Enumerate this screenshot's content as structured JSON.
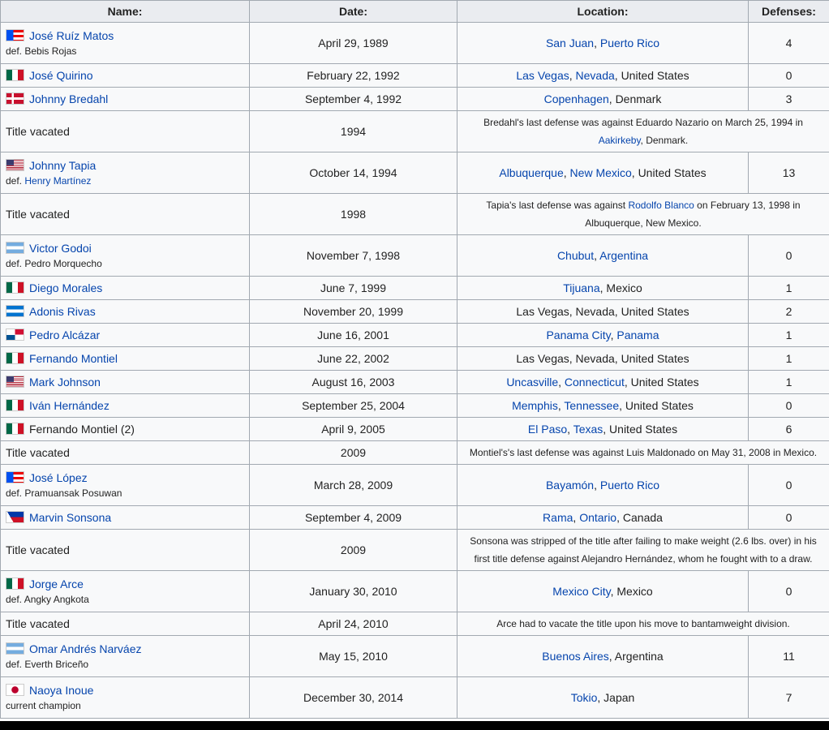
{
  "headers": {
    "name": "Name:",
    "date": "Date:",
    "location": "Location:",
    "defenses": "Defenses:"
  },
  "rows": {
    "r1": {
      "name": "José Ruíz Matos",
      "sub": "def. Bebis Rojas",
      "date": "April 29, 1989",
      "loc1": "San Juan",
      "sep1": ", ",
      "loc2": "Puerto Rico",
      "def": "4",
      "flag": "puerto-rico-flag-icon"
    },
    "r2": {
      "name": "José Quirino",
      "date": "February 22, 1992",
      "loc1": "Las Vegas",
      "sep1": ", ",
      "loc2": "Nevada",
      "loc3": ", United States",
      "def": "0",
      "flag": "mexico-flag-icon"
    },
    "r3": {
      "name": "Johnny Bredahl",
      "date": "September 4, 1992",
      "loc1": "Copenhagen",
      "loc3": ", Denmark",
      "def": "3",
      "flag": "denmark-flag-icon"
    },
    "r4": {
      "name": "Title vacated",
      "date": "1994",
      "n1": "Bredahl's last defense was against Eduardo Nazario on March 25, 1994 in ",
      "n2": "Aakirkeby",
      "n3": ", Denmark."
    },
    "r5": {
      "name": "Johnny Tapia",
      "subpre": "def. ",
      "sublink": "Henry Martínez",
      "date": "October 14, 1994",
      "loc1": "Albuquerque",
      "sep1": ", ",
      "loc2": "New Mexico",
      "loc3": ", United States",
      "def": "13",
      "flag": "united-states-flag-icon"
    },
    "r6": {
      "name": "Title vacated",
      "date": "1998",
      "n1": "Tapia's last defense was against ",
      "n2": "Rodolfo Blanco",
      "n3": " on February 13, 1998 in Albuquerque, New Mexico."
    },
    "r7": {
      "name": "Victor Godoi",
      "sub": "def. Pedro Morquecho",
      "date": "November 7, 1998",
      "loc1": "Chubut",
      "sep1": ", ",
      "loc2": "Argentina",
      "def": "0",
      "flag": "argentina-flag-icon"
    },
    "r8": {
      "name": "Diego Morales",
      "date": "June 7, 1999",
      "loc1": "Tijuana",
      "loc3": ", Mexico",
      "def": "1",
      "flag": "mexico-flag-icon"
    },
    "r9": {
      "name": "Adonis Rivas",
      "date": "November 20, 1999",
      "loc3": "Las Vegas, Nevada, United States",
      "def": "2",
      "flag": "honduras-flag-icon"
    },
    "r10": {
      "name": "Pedro Alcázar",
      "date": "June 16, 2001",
      "loc1": "Panama City",
      "sep1": ", ",
      "loc2": "Panama",
      "def": "1",
      "flag": "panama-flag-icon"
    },
    "r11": {
      "name": "Fernando Montiel",
      "date": "June 22, 2002",
      "loc3": "Las Vegas, Nevada, United States",
      "def": "1",
      "flag": "mexico-flag-icon"
    },
    "r12": {
      "name": "Mark Johnson",
      "date": "August 16, 2003",
      "loc1": "Uncasville",
      "sep1": ", ",
      "loc2": "Connecticut",
      "loc3": ", United States",
      "def": "1",
      "flag": "united-states-flag-icon"
    },
    "r13": {
      "name": "Iván Hernández",
      "date": "September 25, 2004",
      "loc1": "Memphis",
      "sep1": ", ",
      "loc2": "Tennessee",
      "loc3": ", United States",
      "def": "0",
      "flag": "mexico-flag-icon"
    },
    "r14": {
      "name": "Fernando Montiel (2)",
      "date": "April 9, 2005",
      "loc1": "El Paso",
      "sep1": ", ",
      "loc2": "Texas",
      "loc3": ", United States",
      "def": "6",
      "flag": "mexico-flag-icon"
    },
    "r15": {
      "name": "Title vacated",
      "date": "2009",
      "n1": "Montiel's's last defense was against Luis Maldonado on May 31, 2008 in Mexico."
    },
    "r16": {
      "name": "José López",
      "sub": "def. Pramuansak Posuwan",
      "date": "March 28, 2009",
      "loc1": "Bayamón",
      "sep1": ", ",
      "loc2": "Puerto Rico",
      "def": "0",
      "flag": "puerto-rico-flag-icon"
    },
    "r17": {
      "name": "Marvin Sonsona",
      "date": "September 4, 2009",
      "loc1": "Rama",
      "sep1": ", ",
      "loc2": "Ontario",
      "loc3": ", Canada",
      "def": "0",
      "flag": "philippines-flag-icon"
    },
    "r18": {
      "name": "Title vacated",
      "date": "2009",
      "n1": "Sonsona was stripped of the title after failing to make weight (2.6 lbs. over) in his first title defense against Alejandro Hernández, whom he fought with to a draw."
    },
    "r19": {
      "name": "Jorge Arce",
      "sub": "def. Angky Angkota",
      "date": "January 30, 2010",
      "loc1": "Mexico City",
      "loc3": ", Mexico",
      "def": "0",
      "flag": "mexico-flag-icon"
    },
    "r20": {
      "name": "Title vacated",
      "date": "April 24, 2010",
      "n1": "Arce had to vacate the title upon his move to bantamweight division."
    },
    "r21": {
      "name": "Omar Andrés Narváez",
      "sub": "def. Everth Briceño",
      "date": "May 15, 2010",
      "loc1": "Buenos Aires",
      "loc3": ", Argentina",
      "def": "11",
      "flag": "argentina-flag-icon"
    },
    "r22": {
      "name": "Naoya Inoue",
      "sub": "current champion",
      "date": "December 30, 2014",
      "loc1": "Tokio",
      "loc3": ", Japan",
      "def": "7",
      "flag": "japan-flag-icon"
    }
  }
}
